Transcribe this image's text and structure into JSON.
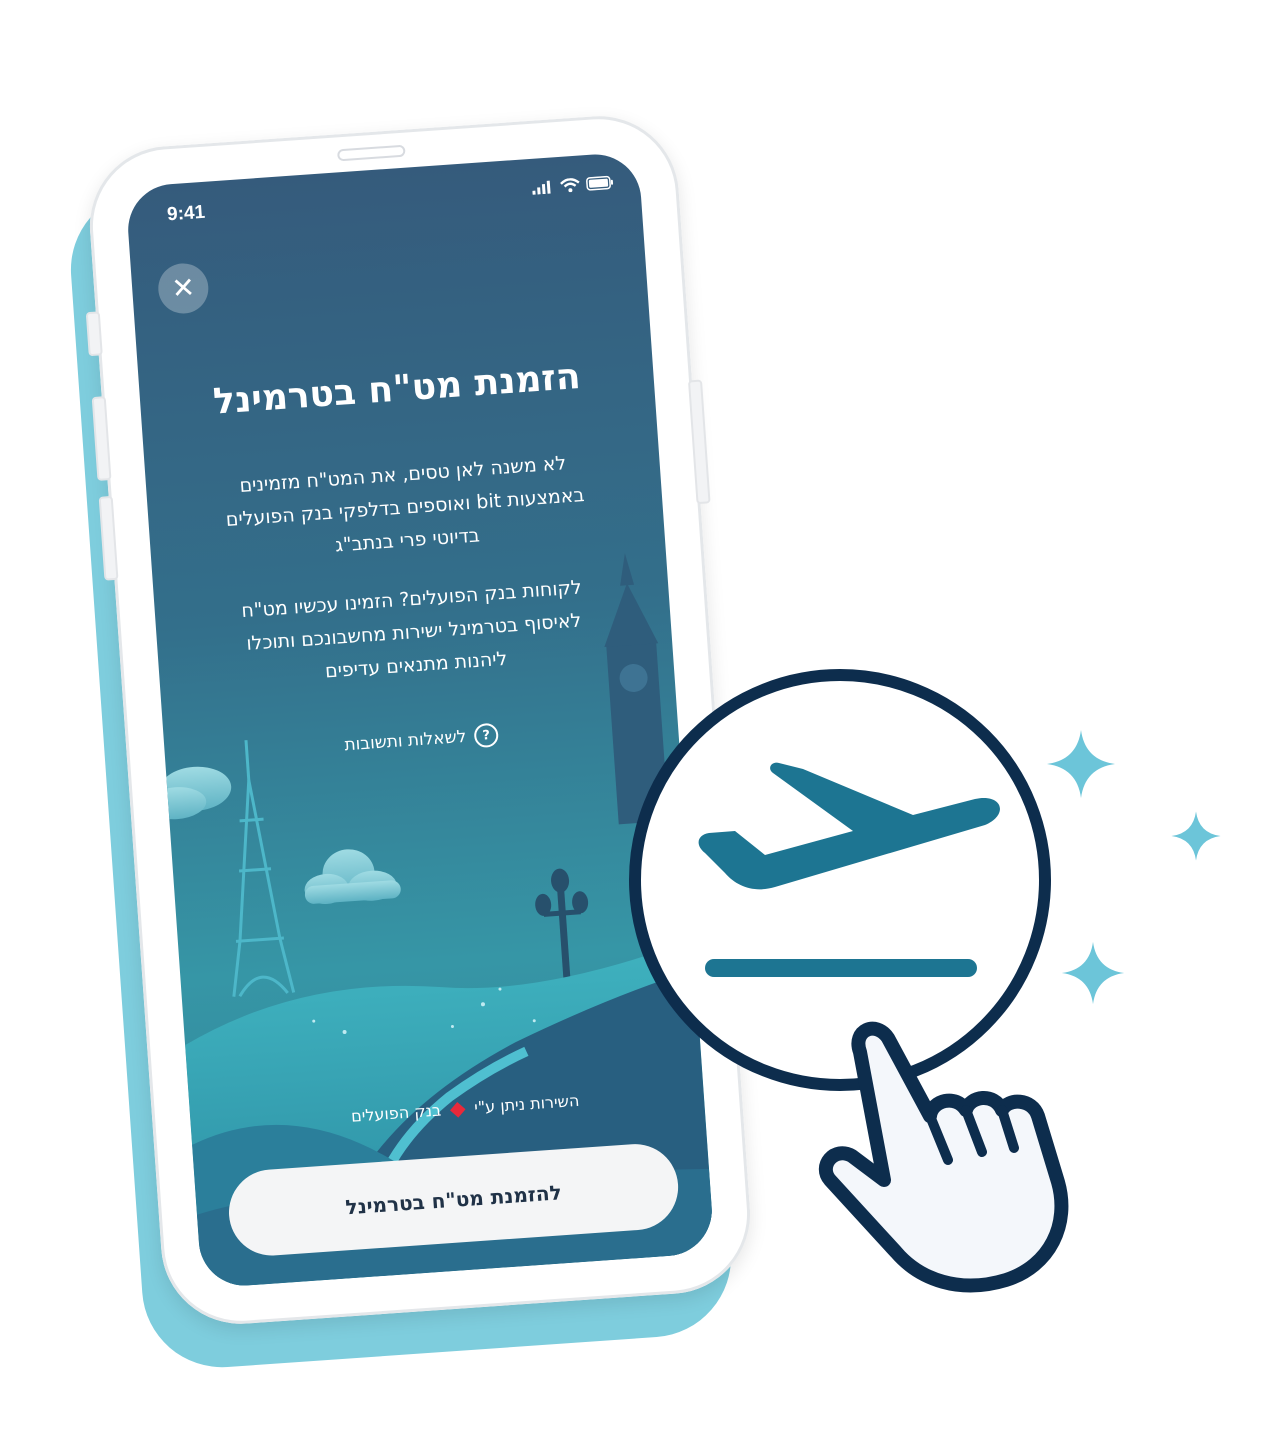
{
  "status_bar": {
    "time": "9:41"
  },
  "close": {
    "label": "✕"
  },
  "intro": {
    "title": "הזמנת מט\"ח בטרמינל",
    "paragraph1": "לא משנה לאן טסים, את המט\"ח מזמינים באמצעות bit ואוספים בדלפקי בנק הפועלים בדיוטי פרי בנתב\"ג",
    "paragraph2": "לקוחות בנק הפועלים? הזמינו עכשיו מט\"ח לאיסוף בטרמינל ישירות מחשבונכם ותוכלו ליהנות מתנאים עדיפים"
  },
  "faq": {
    "label": "לשאלות ותשובות",
    "icon": "question-icon"
  },
  "service": {
    "line1": "השירות ניתן ע\"י",
    "bank_name": "בנק הפועלים"
  },
  "cta": {
    "label": "להזמנת מט\"ח בטרמינל"
  },
  "colors": {
    "accent": "#1d7592",
    "navy": "#0d2d4d",
    "phone_shadow": "#7ecddd",
    "sparkle": "#6cc5d9",
    "bank_diamond": "#e8293a"
  }
}
